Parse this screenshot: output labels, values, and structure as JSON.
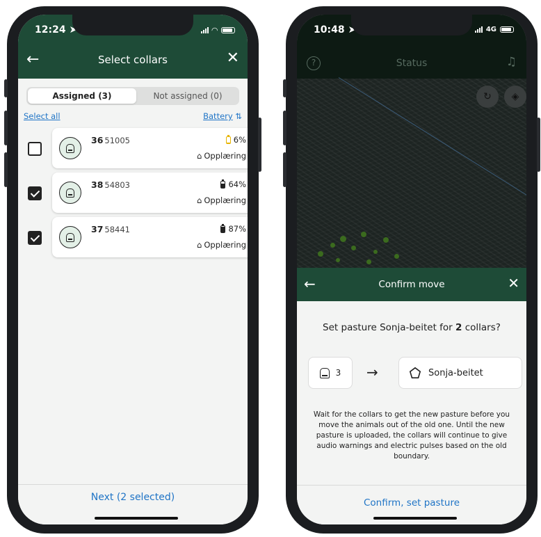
{
  "left": {
    "status_time": "12:24 ➤",
    "header": {
      "title": "Select collars",
      "back_icon": "←",
      "close_icon": "✕"
    },
    "tabs": [
      {
        "label": "Assigned (3)",
        "active": true
      },
      {
        "label": "Not assigned (0)",
        "active": false
      }
    ],
    "select_all": "Select all",
    "sort_label": "Battery",
    "sort_icon": "⇅",
    "collars": [
      {
        "number": "36",
        "id": "51005",
        "battery": "6%",
        "battery_fraction": 0.06,
        "battery_low": true,
        "mode": "Opplæring",
        "checked": false
      },
      {
        "number": "38",
        "id": "54803",
        "battery": "64%",
        "battery_fraction": 0.64,
        "battery_low": false,
        "mode": "Opplæring",
        "checked": true
      },
      {
        "number": "37",
        "id": "58441",
        "battery": "87%",
        "battery_fraction": 0.87,
        "battery_low": false,
        "mode": "Opplæring",
        "checked": true
      }
    ],
    "next_button": "Next (2 selected)"
  },
  "right": {
    "status_time": "10:48 ➤",
    "network": "4G",
    "map_title": "Status",
    "help_icon": "?",
    "sheet": {
      "title": "Confirm move",
      "back_icon": "←",
      "close_icon": "✕",
      "question_pre": "Set pasture Sonja-beitet for ",
      "question_count": "2",
      "question_post": " collars?",
      "from_count": "3",
      "arrow": "→",
      "pasture_name": "Sonja-beitet",
      "description": "Wait for the collars to get the new pasture before you move the animals out of the old one. Until the new pasture is uploaded, the collars will continue to give audio warnings and electric pulses based on the old boundary.",
      "confirm_button": "Confirm, set pasture"
    }
  },
  "colors": {
    "header_green": "#1e4b37",
    "link_blue": "#1f74c6",
    "low_battery": "#e7b400"
  }
}
